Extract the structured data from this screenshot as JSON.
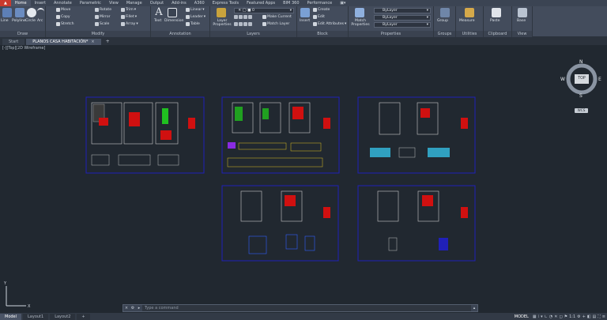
{
  "ribbon_tabs": [
    "Home",
    "Insert",
    "Annotate",
    "Parametric",
    "View",
    "Manage",
    "Output",
    "Add-ins",
    "A360",
    "Express Tools",
    "Featured Apps",
    "BIM 360",
    "Performance"
  ],
  "draw_panel": {
    "title": "Draw",
    "line": "Line",
    "polyline": "Polyline",
    "circle": "Circle",
    "arc": "Arc"
  },
  "modify_panel": {
    "title": "Modify",
    "move": "Move",
    "rotate": "Rotate",
    "trim": "Trim",
    "copy": "Copy",
    "mirror": "Mirror",
    "fillet": "Fillet",
    "stretch": "Stretch",
    "scale": "Scale",
    "array": "Array"
  },
  "annotation_panel": {
    "title": "Annotation",
    "text": "Text",
    "dimension": "Dimension",
    "linear": "Linear",
    "leader": "Leader",
    "table": "Table"
  },
  "layers_panel": {
    "title": "Layers",
    "layer_properties": "Layer Properties",
    "make_current": "Make Current",
    "match_layer": "Match Layer"
  },
  "block_panel": {
    "title": "Block",
    "insert": "Insert",
    "create": "Create",
    "edit": "Edit",
    "edit_attributes": "Edit Attributes"
  },
  "properties_panel": {
    "title": "Properties",
    "match_properties": "Match Properties",
    "color": "ByLayer",
    "linetype": "ByLayer",
    "lineweight": "ByLayer"
  },
  "groups_panel": {
    "title": "Groups",
    "group": "Group"
  },
  "utilities_panel": {
    "title": "Utilities",
    "measure": "Measure"
  },
  "clipboard_panel": {
    "title": "Clipboard",
    "paste": "Paste"
  },
  "view_panel": {
    "title": "View",
    "base": "Base"
  },
  "file_tabs": {
    "start": "Start",
    "drawing": "PLANOS CASA HABITACIÓN*"
  },
  "viewport_controls": "[-][Top][2D Wireframe]",
  "viewcube": {
    "top": "TOP",
    "north": "N",
    "south": "S",
    "east": "E",
    "west": "W",
    "wcs": "WCS"
  },
  "command_placeholder": "Type a command",
  "layout_tabs": [
    "Model",
    "Layout1",
    "Layout2"
  ],
  "status": {
    "model": "MODEL",
    "scale": "1:1"
  },
  "colors": {
    "accent": "#c93a2e",
    "background": "#212830",
    "sheet_border": "#1f1fa8"
  }
}
